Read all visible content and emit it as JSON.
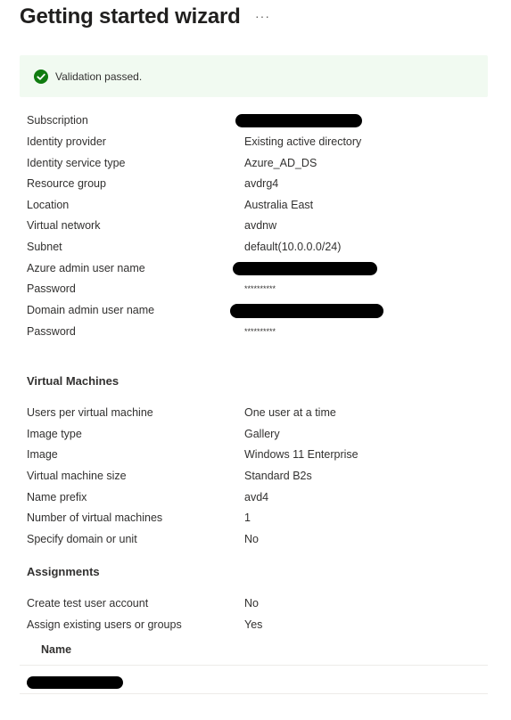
{
  "title": "Getting started wizard",
  "more_label": "···",
  "validation": {
    "message": "Validation passed.",
    "color": "#107c10"
  },
  "basics": [
    {
      "label": "Subscription",
      "value": "",
      "redacted": true
    },
    {
      "label": "Identity provider",
      "value": "Existing active directory"
    },
    {
      "label": "Identity service type",
      "value": "Azure_AD_DS"
    },
    {
      "label": "Resource group",
      "value": "avdrg4"
    },
    {
      "label": "Location",
      "value": "Australia East"
    },
    {
      "label": "Virtual network",
      "value": "avdnw"
    },
    {
      "label": "Subnet",
      "value": "default(10.0.0.0/24)"
    },
    {
      "label": "Azure admin user name",
      "value": "",
      "redacted": true
    },
    {
      "label": "Password",
      "value": "**********"
    },
    {
      "label": "Domain admin user name",
      "value": "",
      "redacted": true
    },
    {
      "label": "Password",
      "value": "**********"
    }
  ],
  "virtual_machines": {
    "heading": "Virtual Machines",
    "rows": [
      {
        "label": "Users per virtual machine",
        "value": "One user at a time"
      },
      {
        "label": "Image type",
        "value": "Gallery"
      },
      {
        "label": "Image",
        "value": "Windows 11 Enterprise"
      },
      {
        "label": "Virtual machine size",
        "value": "Standard B2s"
      },
      {
        "label": "Name prefix",
        "value": "avd4"
      },
      {
        "label": "Number of virtual machines",
        "value": "1"
      },
      {
        "label": "Specify domain or unit",
        "value": "No"
      }
    ]
  },
  "assignments": {
    "heading": "Assignments",
    "rows": [
      {
        "label": "Create test user account",
        "value": "No"
      },
      {
        "label": "Assign existing users or groups",
        "value": "Yes"
      }
    ],
    "table": {
      "column_header": "Name",
      "rows": [
        {
          "name": "",
          "redacted": true
        }
      ]
    }
  }
}
